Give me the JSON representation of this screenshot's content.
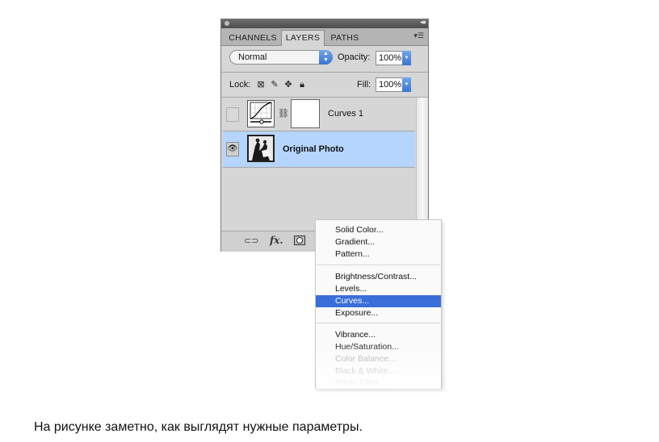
{
  "panel": {
    "tabs": [
      {
        "label": "CHANNELS"
      },
      {
        "label": "LAYERS"
      },
      {
        "label": "PATHS"
      }
    ],
    "active_tab": "LAYERS",
    "blend_mode": "Normal",
    "opacity_label": "Opacity:",
    "opacity_value": "100%",
    "lock_label": "Lock:",
    "fill_label": "Fill:",
    "fill_value": "100%",
    "layers": [
      {
        "name": "Curves 1",
        "visible": false,
        "type": "adjustment"
      },
      {
        "name": "Original Photo",
        "visible": true,
        "type": "image",
        "selected": true
      }
    ],
    "highlight_color": "#b5d5fe"
  },
  "menu": {
    "groups": [
      [
        "Solid Color...",
        "Gradient...",
        "Pattern..."
      ],
      [
        "Brightness/Contrast...",
        "Levels...",
        "Curves...",
        "Exposure..."
      ],
      [
        "Vibrance...",
        "Hue/Saturation...",
        "Color Balance...",
        "Black & White...",
        "Photo Filter..."
      ]
    ],
    "highlighted_item": "Curves...",
    "highlight_color": "#3a6fd8"
  },
  "caption": "На рисунке заметно, как выглядят нужные параметры."
}
